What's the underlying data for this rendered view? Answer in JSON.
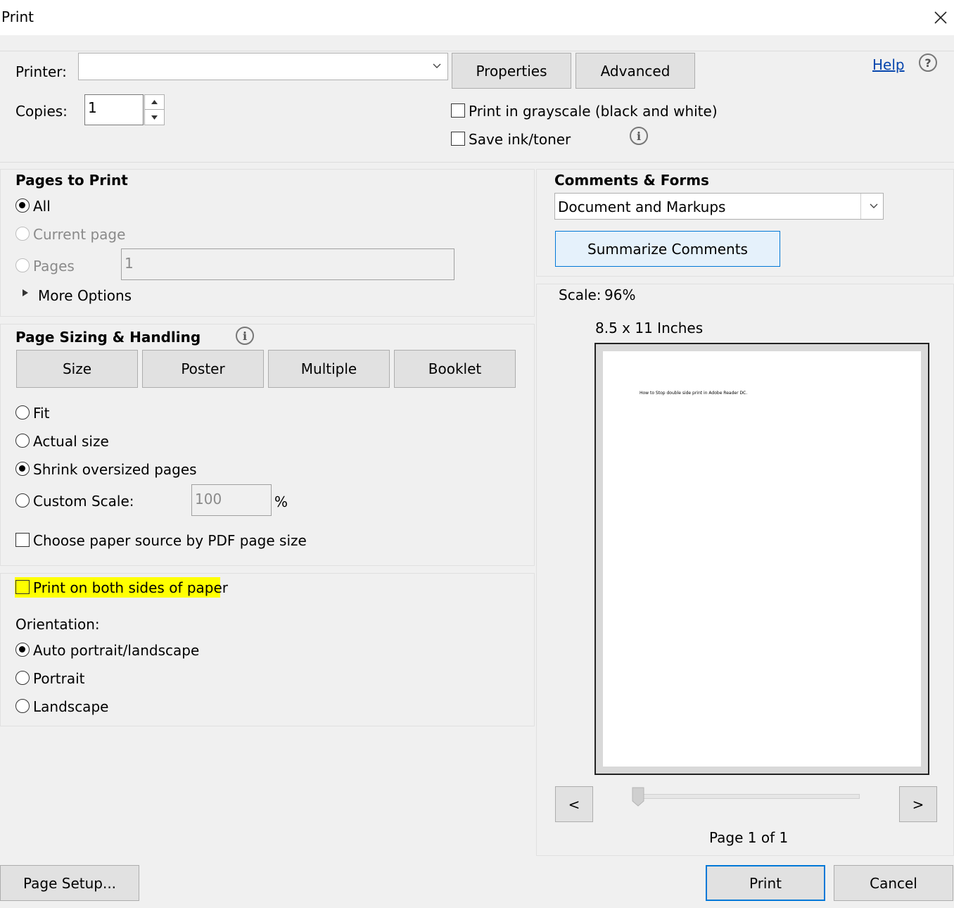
{
  "dialog": {
    "title": "Print"
  },
  "printer": {
    "label": "Printer:",
    "value": "",
    "properties_label": "Properties",
    "advanced_label": "Advanced",
    "help_label": "Help"
  },
  "copies": {
    "label": "Copies:",
    "value": "1"
  },
  "options": {
    "grayscale_label": "Print in grayscale (black and white)",
    "save_ink_label": "Save ink/toner"
  },
  "pages_to_print": {
    "heading": "Pages to Print",
    "all_label": "All",
    "current_page_label": "Current page",
    "pages_label": "Pages",
    "pages_value": "1",
    "more_options_label": "More Options",
    "selected": "All"
  },
  "page_sizing": {
    "heading": "Page Sizing & Handling",
    "tabs": [
      "Size",
      "Poster",
      "Multiple",
      "Booklet"
    ],
    "fit_label": "Fit",
    "actual_size_label": "Actual size",
    "shrink_label": "Shrink oversized pages",
    "custom_scale_label": "Custom Scale:",
    "custom_scale_value": "100",
    "percent_sign": "%",
    "paper_source_label": "Choose paper source by PDF page size",
    "selected": "Shrink oversized pages"
  },
  "duplex": {
    "label": "Print on both sides of paper",
    "highlight_color": "#ffff00"
  },
  "orientation": {
    "label": "Orientation:",
    "auto_label": "Auto portrait/landscape",
    "portrait_label": "Portrait",
    "landscape_label": "Landscape",
    "selected": "Auto portrait/landscape"
  },
  "comments_forms": {
    "heading": "Comments & Forms",
    "selected_option": "Document and Markups",
    "summarize_label": "Summarize Comments"
  },
  "preview": {
    "scale_label": "Scale:",
    "scale_value": "96%",
    "paper_size": "8.5 x 11 Inches",
    "page_text": "How to Stop double side print in Adobe Reader DC.",
    "prev_label": "<",
    "next_label": ">",
    "page_indicator": "Page 1 of 1",
    "slider_position": 0
  },
  "footer": {
    "page_setup_label": "Page Setup...",
    "print_label": "Print",
    "cancel_label": "Cancel"
  },
  "colors": {
    "accent_button_bg": "#e5f1fb",
    "accent_button_border": "#0078d7",
    "link": "#0645ad"
  }
}
